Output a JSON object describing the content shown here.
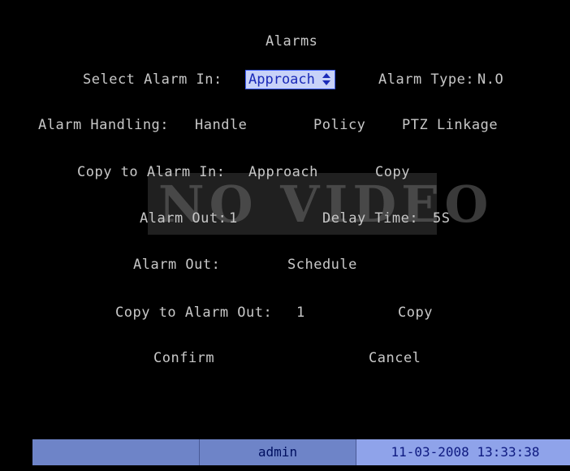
{
  "title": "Alarms",
  "select_alarm_in": {
    "label": "Select Alarm In:",
    "value": "Approach"
  },
  "alarm_type": {
    "label": "Alarm Type:",
    "value": "N.O"
  },
  "alarm_handling": {
    "label": "Alarm Handling:",
    "handle": "Handle",
    "policy": "Policy",
    "ptz_linkage": "PTZ Linkage"
  },
  "copy_alarm_in": {
    "label": "Copy to Alarm In:",
    "value": "Approach",
    "copy": "Copy"
  },
  "watermark": "NO VIDEO",
  "alarm_out_delay": {
    "label": "Alarm Out:",
    "value": "1",
    "delay_label": "Delay Time:",
    "delay_value": "5S"
  },
  "alarm_out_schedule": {
    "label": "Alarm Out:",
    "schedule": "Schedule"
  },
  "copy_alarm_out": {
    "label": "Copy to Alarm Out:",
    "value": "1",
    "copy": "Copy"
  },
  "buttons": {
    "confirm": "Confirm",
    "cancel": "Cancel"
  },
  "statusbar": {
    "left": "",
    "user": "admin",
    "datetime": "11-03-2008 13:33:38"
  },
  "colors": {
    "background": "#000000",
    "text": "#c8c8c8",
    "highlight": "#c8d2f8",
    "statusbar": "#6e84c8"
  }
}
